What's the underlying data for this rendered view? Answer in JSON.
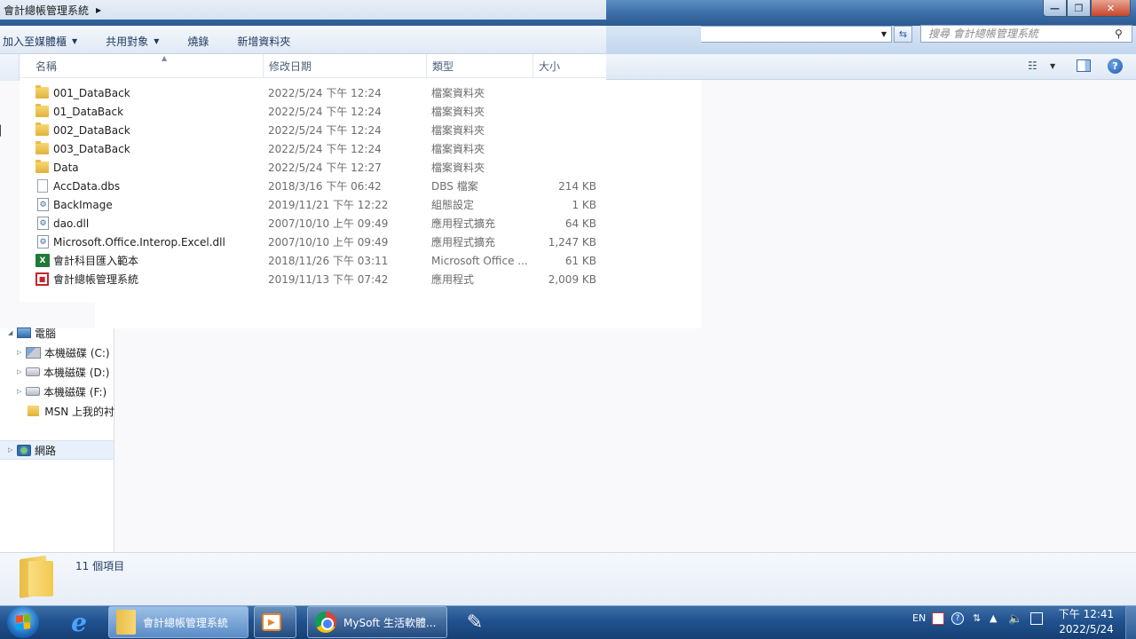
{
  "window": {
    "title": "會計總帳管理系統",
    "minimize_glyph": "—",
    "maximize_glyph": "❐",
    "close_glyph": "✕"
  },
  "search": {
    "placeholder": "搜尋 會計總帳管理系統"
  },
  "toolbar": {
    "items": [
      {
        "label": "加入至媒體櫃",
        "has_dropdown": true
      },
      {
        "label": "共用對象",
        "has_dropdown": true
      },
      {
        "label": "燒錄",
        "has_dropdown": false
      },
      {
        "label": "新增資料夾",
        "has_dropdown": false
      }
    ]
  },
  "columns": {
    "name": "名稱",
    "date": "修改日期",
    "type": "類型",
    "size": "大小"
  },
  "files": [
    {
      "icon": "folder-icon",
      "name": "001_DataBack",
      "date": "2022/5/24 下午 12:24",
      "type": "檔案資料夾",
      "size": ""
    },
    {
      "icon": "folder-icon",
      "name": "01_DataBack",
      "date": "2022/5/24 下午 12:24",
      "type": "檔案資料夾",
      "size": ""
    },
    {
      "icon": "folder-icon",
      "name": "002_DataBack",
      "date": "2022/5/24 下午 12:24",
      "type": "檔案資料夾",
      "size": ""
    },
    {
      "icon": "folder-icon",
      "name": "003_DataBack",
      "date": "2022/5/24 下午 12:24",
      "type": "檔案資料夾",
      "size": ""
    },
    {
      "icon": "folder-icon",
      "name": "Data",
      "date": "2022/5/24 下午 12:27",
      "type": "檔案資料夾",
      "size": ""
    },
    {
      "icon": "file-icon",
      "name": "AccData.dbs",
      "date": "2018/3/16 下午 06:42",
      "type": "DBS 檔案",
      "size": "214 KB"
    },
    {
      "icon": "settings-file-icon",
      "name": "BackImage",
      "date": "2019/11/21 下午 12:22",
      "type": "組態設定",
      "size": "1 KB"
    },
    {
      "icon": "dll-icon",
      "name": "dao.dll",
      "date": "2007/10/10 上午 09:49",
      "type": "應用程式擴充",
      "size": "64 KB"
    },
    {
      "icon": "dll-icon",
      "name": "Microsoft.Office.Interop.Excel.dll",
      "date": "2007/10/10 上午 09:49",
      "type": "應用程式擴充",
      "size": "1,247 KB"
    },
    {
      "icon": "excel-icon",
      "name": "會計科目匯入範本",
      "date": "2018/11/26 下午 03:11",
      "type": "Microsoft Office ...",
      "size": "61 KB"
    },
    {
      "icon": "app-icon",
      "name": "會計總帳管理系統",
      "date": "2019/11/13 下午 07:42",
      "type": "應用程式",
      "size": "2,009 KB"
    }
  ],
  "nav": {
    "computer": "電腦",
    "drive_c": "本機磁碟 (C:)",
    "drive_d": "本機磁碟 (D:)",
    "drive_f": "本機磁碟 (F:)",
    "msn": "MSN 上我的衬",
    "network": "網路"
  },
  "details": {
    "count": "11 個項目"
  },
  "taskbar": {
    "explorer_label": "會計總帳管理系統",
    "chrome_label": "MySoft 生活軟體...",
    "language": "EN",
    "time": "下午 12:41",
    "date": "2022/5/24"
  }
}
